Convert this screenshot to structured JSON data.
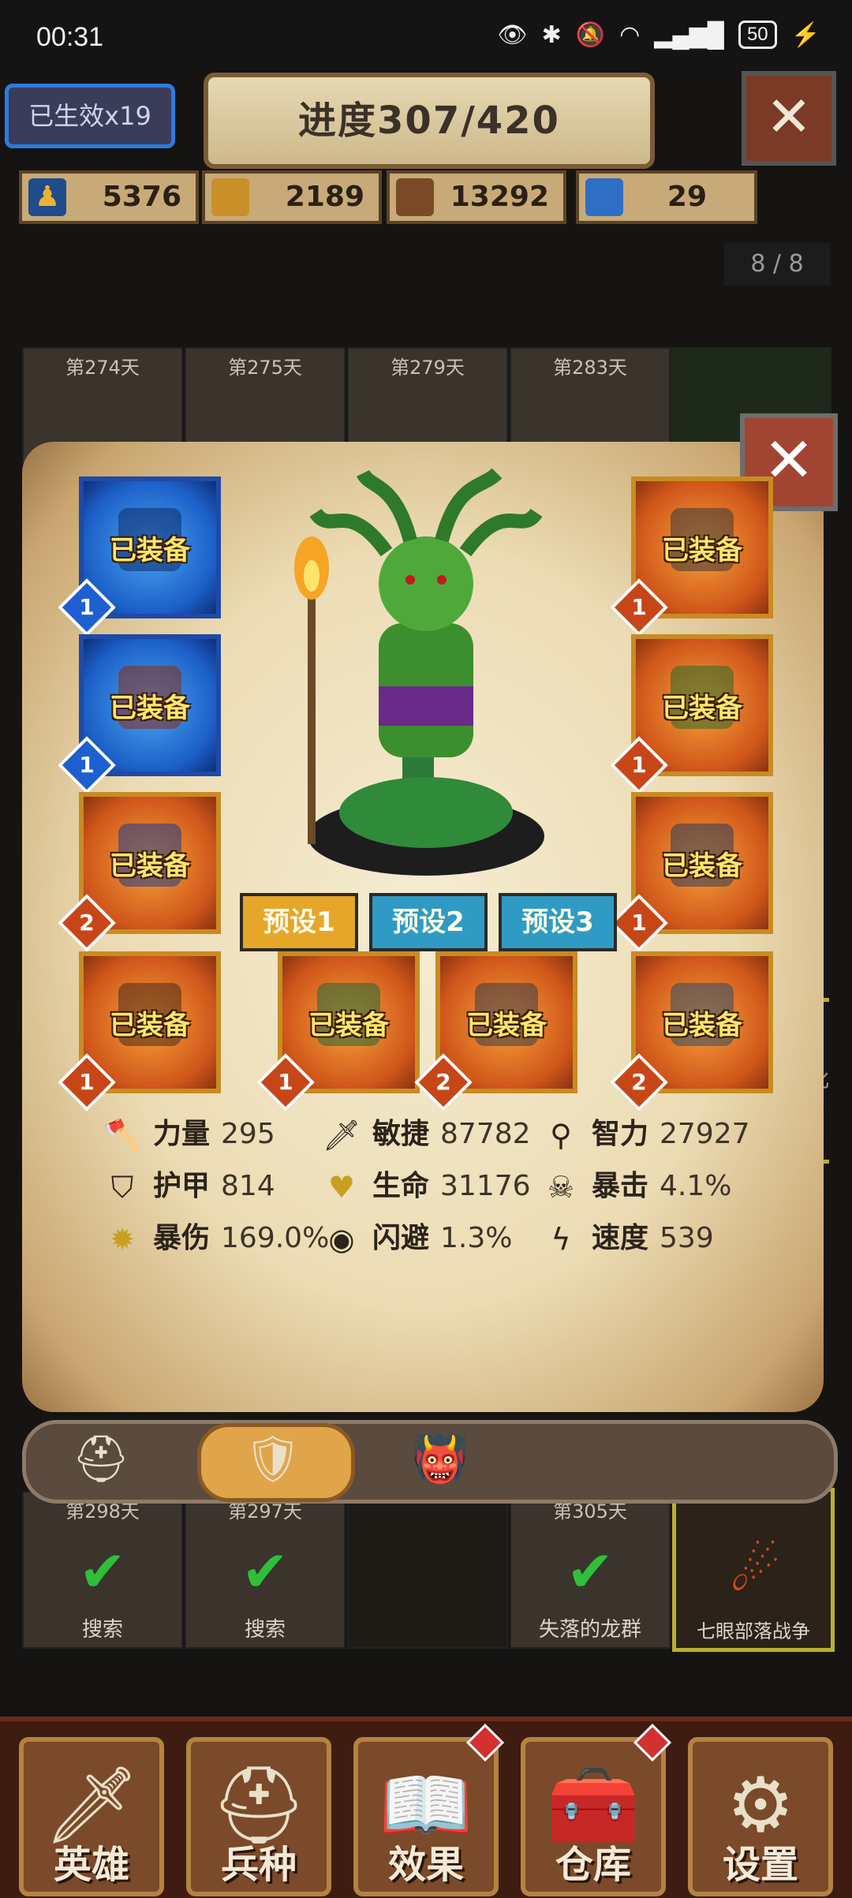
{
  "status_bar": {
    "time": "00:31",
    "battery": "50",
    "icons": [
      "eye-icon",
      "bluetooth-icon",
      "mute-icon",
      "wifi-icon",
      "5g-signal-icon",
      "charging-icon"
    ]
  },
  "header": {
    "effect_count": "已生效x19",
    "progress": "进度307/420",
    "resources": [
      {
        "icon": "population-icon",
        "value": "5376"
      },
      {
        "icon": "gold-coins-icon",
        "value": "2189"
      },
      {
        "icon": "wood-logs-icon",
        "value": "13292"
      },
      {
        "icon": "crystal-staff-icon",
        "value": "29"
      }
    ],
    "page_indicator": "8 / 8"
  },
  "background_tiles": {
    "top_days": [
      "第274天",
      "第275天",
      "第279天",
      "第283天"
    ],
    "bottom_days": [
      "第298天",
      "第297天",
      "",
      "第305天"
    ],
    "bottom_captions": [
      "搜索",
      "搜索",
      "",
      "失落的龙群",
      "七眼部落战争"
    ],
    "side_caption": "化"
  },
  "equipment": {
    "equipped_label": "已装备",
    "slots": [
      {
        "name": "hood",
        "tier": "1",
        "rarity": "blue"
      },
      {
        "name": "chest-armor",
        "tier": "1",
        "rarity": "blue"
      },
      {
        "name": "gauntlet",
        "tier": "2",
        "rarity": "orange"
      },
      {
        "name": "skull-staff",
        "tier": "1",
        "rarity": "orange"
      },
      {
        "name": "horned-shield",
        "tier": "1",
        "rarity": "orange"
      },
      {
        "name": "crystal-ring",
        "tier": "2",
        "rarity": "orange"
      },
      {
        "name": "amulet",
        "tier": "2",
        "rarity": "orange"
      },
      {
        "name": "shoulder-guard",
        "tier": "1",
        "rarity": "orange"
      },
      {
        "name": "boots",
        "tier": "1",
        "rarity": "orange"
      },
      {
        "name": "mount",
        "tier": "1",
        "rarity": "orange"
      }
    ]
  },
  "presets": [
    {
      "label": "预设1",
      "active": true
    },
    {
      "label": "预设2",
      "active": false
    },
    {
      "label": "预设3",
      "active": false
    }
  ],
  "stats": [
    {
      "icon": "axe-icon",
      "label": "力量",
      "value": "295"
    },
    {
      "icon": "sword-icon",
      "label": "敏捷",
      "value": "87782"
    },
    {
      "icon": "wand-icon",
      "label": "智力",
      "value": "27927"
    },
    {
      "icon": "shield-icon",
      "label": "护甲",
      "value": "814"
    },
    {
      "icon": "heart-icon",
      "label": "生命",
      "value": "31176"
    },
    {
      "icon": "skull-icon",
      "label": "暴击",
      "value": "4.1%"
    },
    {
      "icon": "burst-icon",
      "label": "暴伤",
      "value": "169.0%"
    },
    {
      "icon": "eye-icon",
      "label": "闪避",
      "value": "1.3%"
    },
    {
      "icon": "lightning-icon",
      "label": "速度",
      "value": "539"
    }
  ],
  "hero_tabs": [
    {
      "icon": "horned-helmet-icon"
    },
    {
      "icon": "crest-shield-icon",
      "active": true
    },
    {
      "icon": "orc-warrior-icon"
    }
  ],
  "bottom_nav": [
    {
      "label": "英雄",
      "icon": "sword-icon",
      "badge": false
    },
    {
      "label": "兵种",
      "icon": "knight-helmet-icon",
      "badge": false
    },
    {
      "label": "效果",
      "icon": "spellbook-icon",
      "badge": true
    },
    {
      "label": "仓库",
      "icon": "treasure-chest-icon",
      "badge": true
    },
    {
      "label": "设置",
      "icon": "gear-icon",
      "badge": false
    }
  ],
  "colors": {
    "accent_orange": "#d0561a",
    "rare_blue": "#1c5fc8",
    "parchment": "#ecdcb4",
    "preset_active": "#e6a62a",
    "preset_inactive": "#2f9bc4"
  }
}
